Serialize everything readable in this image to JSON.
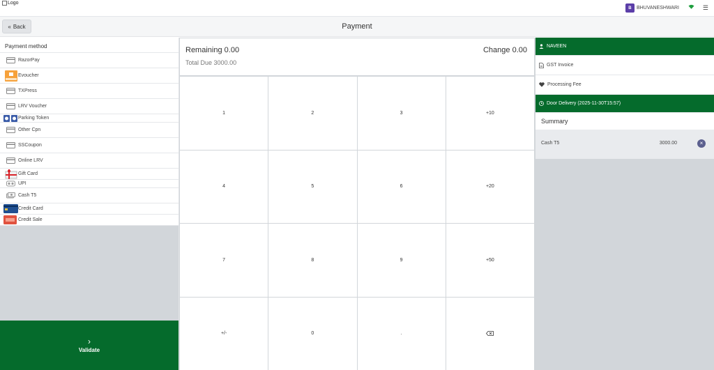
{
  "topbar": {
    "logo_text": "Logo",
    "user_initial": "B",
    "user_name": "BHUVANESHWARI"
  },
  "header": {
    "back_label": "Back",
    "title": "Payment"
  },
  "payment_methods": {
    "title": "Payment method",
    "items": [
      {
        "label": "RazorPay"
      },
      {
        "label": "Evoucher"
      },
      {
        "label": "TXPress"
      },
      {
        "label": "LRV Voucher"
      },
      {
        "label": "Parking Token"
      },
      {
        "label": "Other Cpn"
      },
      {
        "label": "SSCoupon"
      },
      {
        "label": "Online LRV"
      },
      {
        "label": "Gift Card"
      },
      {
        "label": "UPI"
      },
      {
        "label": "Cash T5"
      },
      {
        "label": "Credit Card"
      },
      {
        "label": "Credit Sale"
      }
    ]
  },
  "validate": {
    "label": "Validate"
  },
  "amounts": {
    "remaining_label": "Remaining",
    "remaining_value": "0.00",
    "change_label": "Change",
    "change_value": "0.00",
    "total_due_label": "Total Due",
    "total_due_value": "3000.00"
  },
  "keypad": [
    "1",
    "2",
    "3",
    "+10",
    "4",
    "5",
    "6",
    "+20",
    "7",
    "8",
    "9",
    "+50",
    "+/-",
    "0",
    "."
  ],
  "customer": {
    "name": "NAVEEN"
  },
  "options": {
    "gst_invoice": "GST Invoice",
    "processing_fee": "Processing Fee",
    "door_delivery": "Door Delivery (2025-11-30T15:57)"
  },
  "summary": {
    "title": "Summary",
    "lines": [
      {
        "name": "Cash T5",
        "amount": "3000.00"
      }
    ]
  },
  "colors": {
    "green": "#056b2c",
    "avatar": "#5b3ea8",
    "remove": "#5b5f8e"
  }
}
